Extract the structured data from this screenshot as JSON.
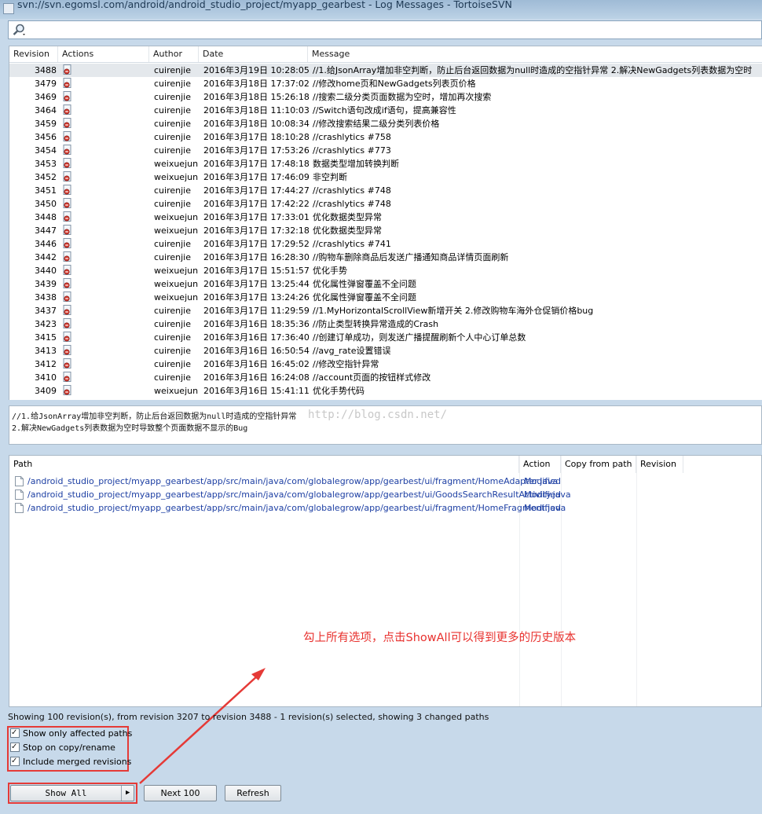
{
  "window": {
    "title": "svn://svn.egomsl.com/android/android_studio_project/myapp_gearbest - Log Messages - TortoiseSVN"
  },
  "search": {
    "value": "",
    "icon": "search-icon"
  },
  "log_table": {
    "headers": {
      "revision": "Revision",
      "actions": "Actions",
      "author": "Author",
      "date": "Date",
      "message": "Message"
    },
    "rows": [
      {
        "revision": "3488",
        "author": "cuirenjie",
        "date": "2016年3月19日 10:28:05",
        "message": "//1.给JsonArray增加非空判断，防止后台返回数据为null时造成的空指针异常 2.解决NewGadgets列表数据为空时",
        "selected": true
      },
      {
        "revision": "3479",
        "author": "cuirenjie",
        "date": "2016年3月18日 17:37:02",
        "message": "//修改home页和NewGadgets列表页价格"
      },
      {
        "revision": "3469",
        "author": "cuirenjie",
        "date": "2016年3月18日 15:26:18",
        "message": "//搜索二级分类页面数据为空时，增加再次搜索"
      },
      {
        "revision": "3464",
        "author": "cuirenjie",
        "date": "2016年3月18日 11:10:03",
        "message": "//Switch语句改成if语句，提高兼容性"
      },
      {
        "revision": "3459",
        "author": "cuirenjie",
        "date": "2016年3月18日 10:08:34",
        "message": "//修改搜索结果二级分类列表价格"
      },
      {
        "revision": "3456",
        "author": "cuirenjie",
        "date": "2016年3月17日 18:10:28",
        "message": "//crashlytics #758"
      },
      {
        "revision": "3454",
        "author": "cuirenjie",
        "date": "2016年3月17日 17:53:26",
        "message": "//crashlytics #773"
      },
      {
        "revision": "3453",
        "author": "weixuejun",
        "date": "2016年3月17日 17:48:18",
        "message": "数据类型增加转换判断"
      },
      {
        "revision": "3452",
        "author": "weixuejun",
        "date": "2016年3月17日 17:46:09",
        "message": "非空判断"
      },
      {
        "revision": "3451",
        "author": "cuirenjie",
        "date": "2016年3月17日 17:44:27",
        "message": "//crashlytics #748"
      },
      {
        "revision": "3450",
        "author": "cuirenjie",
        "date": "2016年3月17日 17:42:22",
        "message": "//crashlytics #748"
      },
      {
        "revision": "3448",
        "author": "weixuejun",
        "date": "2016年3月17日 17:33:01",
        "message": "优化数据类型异常"
      },
      {
        "revision": "3447",
        "author": "weixuejun",
        "date": "2016年3月17日 17:32:18",
        "message": "优化数据类型异常"
      },
      {
        "revision": "3446",
        "author": "cuirenjie",
        "date": "2016年3月17日 17:29:52",
        "message": "//crashlytics #741"
      },
      {
        "revision": "3442",
        "author": "cuirenjie",
        "date": "2016年3月17日 16:28:30",
        "message": "//购物车删除商品后发送广播通知商品详情页面刷新"
      },
      {
        "revision": "3440",
        "author": "weixuejun",
        "date": "2016年3月17日 15:51:57",
        "message": "优化手势"
      },
      {
        "revision": "3439",
        "author": "weixuejun",
        "date": "2016年3月17日 13:25:44",
        "message": "优化属性弹窗覆盖不全问题"
      },
      {
        "revision": "3438",
        "author": "weixuejun",
        "date": "2016年3月17日 13:24:26",
        "message": "优化属性弹窗覆盖不全问题"
      },
      {
        "revision": "3437",
        "author": "cuirenjie",
        "date": "2016年3月17日 11:29:59",
        "message": "//1.MyHorizontalScrollView新增开关 2.修改购物车海外仓促销价格bug"
      },
      {
        "revision": "3423",
        "author": "cuirenjie",
        "date": "2016年3月16日 18:35:36",
        "message": "//防止类型转换异常造成的Crash"
      },
      {
        "revision": "3415",
        "author": "cuirenjie",
        "date": "2016年3月16日 17:36:40",
        "message": "//创建订单成功，则发送广播提醒刷新个人中心订单总数"
      },
      {
        "revision": "3413",
        "author": "cuirenjie",
        "date": "2016年3月16日 16:50:54",
        "message": "//avg_rate设置错误"
      },
      {
        "revision": "3412",
        "author": "cuirenjie",
        "date": "2016年3月16日 16:45:02",
        "message": "//修改空指针异常"
      },
      {
        "revision": "3410",
        "author": "cuirenjie",
        "date": "2016年3月16日 16:24:08",
        "message": "//account页面的按钮样式修改"
      },
      {
        "revision": "3409",
        "author": "weixuejun",
        "date": "2016年3月16日 15:41:11",
        "message": "优化手势代码"
      }
    ]
  },
  "message_detail": {
    "line1": "//1.给JsonArray增加非空判断，防止后台返回数据为null时造成的空指针异常",
    "line2": "2.解决NewGadgets列表数据为空时导致整个页面数据不显示的Bug",
    "watermark": "http://blog.csdn.net/"
  },
  "paths_table": {
    "headers": {
      "path": "Path",
      "action": "Action",
      "copy_from_path": "Copy from path",
      "revision": "Revision"
    },
    "rows": [
      {
        "path": "/android_studio_project/myapp_gearbest/app/src/main/java/com/globalegrow/app/gearbest/ui/fragment/HomeAdapter.java",
        "action": "Modified"
      },
      {
        "path": "/android_studio_project/myapp_gearbest/app/src/main/java/com/globalegrow/app/gearbest/ui/GoodsSearchResultActivity.java",
        "action": "Modified"
      },
      {
        "path": "/android_studio_project/myapp_gearbest/app/src/main/java/com/globalegrow/app/gearbest/ui/fragment/HomeFragment.java",
        "action": "Modified"
      }
    ]
  },
  "annotation": "勾上所有选项，点击ShowAll可以得到更多的历史版本",
  "status": "Showing 100 revision(s), from revision 3207 to revision 3488 - 1 revision(s) selected, showing 3 changed paths",
  "options": {
    "show_only_affected": {
      "label": "Show only affected paths",
      "checked": true
    },
    "stop_on_copy": {
      "label": "Stop on copy/rename",
      "checked": true
    },
    "include_merged": {
      "label": "Include merged revisions",
      "checked": true
    }
  },
  "buttons": {
    "show_all": "Show All",
    "next_100": "Next 100",
    "refresh": "Refresh"
  },
  "colors": {
    "annotation_red": "#e53a37",
    "path_blue": "#1d3fa3",
    "selected_row": "#e4e8ec"
  }
}
